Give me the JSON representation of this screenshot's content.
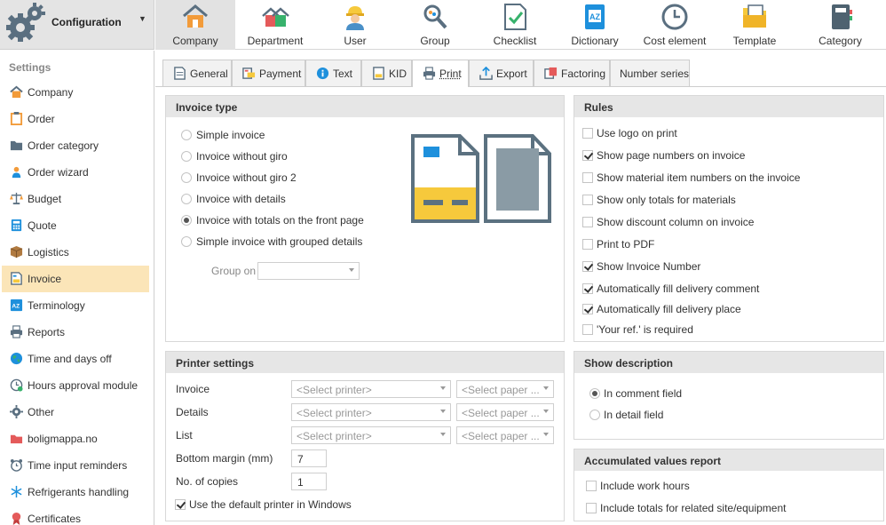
{
  "header": {
    "title": "Configuration"
  },
  "topnav": [
    {
      "label": "Company",
      "icon": "home-icon",
      "active": true
    },
    {
      "label": "Department",
      "icon": "houses-icon"
    },
    {
      "label": "User",
      "icon": "worker-icon"
    },
    {
      "label": "Group",
      "icon": "group-search-icon"
    },
    {
      "label": "Checklist",
      "icon": "checklist-icon"
    },
    {
      "label": "Dictionary",
      "icon": "dictionary-icon"
    },
    {
      "label": "Cost element",
      "icon": "clock-icon"
    },
    {
      "label": "Template",
      "icon": "template-folder-icon"
    },
    {
      "label": "Category",
      "icon": "category-book-icon"
    }
  ],
  "sidebar": {
    "heading": "Settings",
    "items": [
      {
        "label": "Company",
        "icon": "home-icon"
      },
      {
        "label": "Order",
        "icon": "clipboard-icon"
      },
      {
        "label": "Order category",
        "icon": "folder-icon"
      },
      {
        "label": "Order wizard",
        "icon": "wizard-icon"
      },
      {
        "label": "Budget",
        "icon": "scales-icon"
      },
      {
        "label": "Quote",
        "icon": "calculator-icon"
      },
      {
        "label": "Logistics",
        "icon": "box-icon"
      },
      {
        "label": "Invoice",
        "icon": "invoice-icon",
        "active": true
      },
      {
        "label": "Terminology",
        "icon": "terminology-icon"
      },
      {
        "label": "Reports",
        "icon": "printer-icon"
      },
      {
        "label": "Time and days off",
        "icon": "globe-icon"
      },
      {
        "label": "Hours approval module",
        "icon": "clock-check-icon"
      },
      {
        "label": "Other",
        "icon": "gear-icon"
      },
      {
        "label": "boligmappa.no",
        "icon": "boligmappa-icon"
      },
      {
        "label": "Time input reminders",
        "icon": "alarm-clock-icon"
      },
      {
        "label": "Refrigerants handling",
        "icon": "snowflake-icon"
      },
      {
        "label": "Certificates",
        "icon": "certificate-icon"
      }
    ]
  },
  "tabs": [
    {
      "label": "General",
      "icon": "document-icon"
    },
    {
      "label": "Payment",
      "icon": "payment-icon"
    },
    {
      "label": "Text",
      "icon": "info-icon"
    },
    {
      "label": "KID",
      "icon": "kid-icon"
    },
    {
      "label": "Print",
      "icon": "printer-icon",
      "active": true
    },
    {
      "label": "Export",
      "icon": "export-icon"
    },
    {
      "label": "Factoring",
      "icon": "factoring-icon"
    },
    {
      "label": "Number series",
      "icon": ""
    }
  ],
  "invoice_type": {
    "title": "Invoice type",
    "options": [
      {
        "label": "Simple invoice",
        "selected": false
      },
      {
        "label": "Invoice without giro",
        "selected": false
      },
      {
        "label": "Invoice without giro 2",
        "selected": false
      },
      {
        "label": "Invoice with details",
        "selected": false
      },
      {
        "label": "Invoice with totals on the front page",
        "selected": true
      },
      {
        "label": "Simple invoice with grouped details",
        "selected": false
      }
    ],
    "group_on_label": "Group on",
    "group_on_value": ""
  },
  "rules": {
    "title": "Rules",
    "items": [
      {
        "label": "Use logo on print",
        "checked": false
      },
      {
        "label": "Show page numbers on invoice",
        "checked": true
      },
      {
        "label": "Show material item numbers on the invoice",
        "checked": false
      },
      {
        "label": "Show only totals for materials",
        "checked": false
      },
      {
        "label": "Show discount column on invoice",
        "checked": false
      },
      {
        "label": "Print to PDF",
        "checked": false
      },
      {
        "label": "Show Invoice Number",
        "checked": true
      },
      {
        "label": "Automatically fill delivery comment",
        "checked": true
      },
      {
        "label": "Automatically fill delivery place",
        "checked": true
      },
      {
        "label": "'Your ref.' is required",
        "checked": false
      }
    ]
  },
  "printer_settings": {
    "title": "Printer settings",
    "rows": [
      {
        "label": "Invoice",
        "printer": "<Select printer>",
        "paper": "<Select paper ..."
      },
      {
        "label": "Details",
        "printer": "<Select printer>",
        "paper": "<Select paper ..."
      },
      {
        "label": "List",
        "printer": "<Select printer>",
        "paper": "<Select paper ..."
      }
    ],
    "bottom_margin_label": "Bottom margin (mm)",
    "bottom_margin_value": "7",
    "copies_label": "No. of copies",
    "copies_value": "1",
    "default_printer_label": "Use the default printer in Windows",
    "default_printer_checked": true
  },
  "show_description": {
    "title": "Show description",
    "options": [
      {
        "label": "In comment field",
        "selected": true
      },
      {
        "label": "In detail field",
        "selected": false
      }
    ]
  },
  "accumulated": {
    "title": "Accumulated values report",
    "items": [
      {
        "label": "Include work hours",
        "checked": false
      },
      {
        "label": "Include totals for related site/equipment",
        "checked": false
      }
    ]
  },
  "colors": {
    "active_sidebar": "#fbe5b8",
    "panel_header": "#e6e6e6",
    "invoice_blue": "#1e90dc",
    "invoice_yellow": "#f6c93c",
    "invoice_slate": "#5b7180"
  }
}
